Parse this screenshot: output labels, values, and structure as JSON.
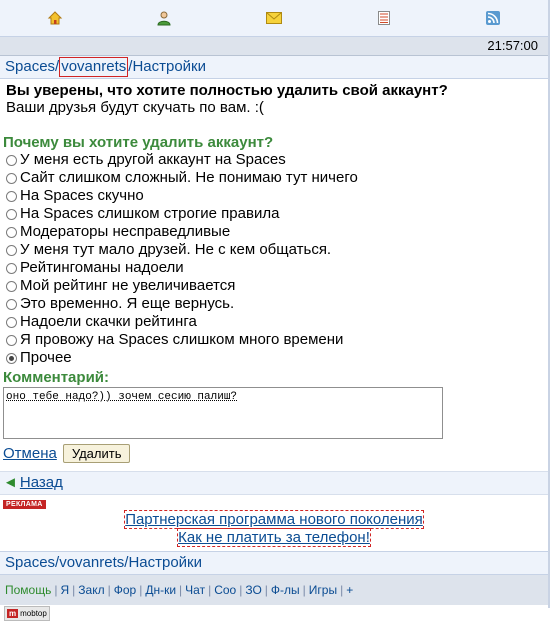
{
  "topnav": {
    "icons": [
      "home-icon",
      "user-icon",
      "mail-icon",
      "list-icon",
      "rss-icon"
    ]
  },
  "time": "21:57:00",
  "breadcrumb": {
    "site": "Spaces",
    "user": "vovanrets",
    "page": "Настройки"
  },
  "question": {
    "title": "Вы уверены, что хотите полностью удалить свой аккаунт?",
    "subtitle": "Ваши друзья будут скучать по вам. :("
  },
  "reasons": {
    "title": "Почему вы хотите удалить аккаунт?",
    "options": [
      "У меня есть другой аккаунт на Spaces",
      "Сайт слишком сложный. Не понимаю тут ничего",
      "На Spaces скучно",
      "На Spaces слишком строгие правила",
      "Модераторы несправедливые",
      "У меня тут мало друзей. Не с кем общаться.",
      "Рейтингоманы надоели",
      "Мой рейтинг не увеличивается",
      "Это временно. Я еще вернусь.",
      "Надоели скачки рейтинга",
      "Я провожу на Spaces слишком много времени",
      "Прочее"
    ],
    "selected_index": 11
  },
  "comment": {
    "label": "Комментарий:",
    "value": "оно тебе надо?)) зочем сесию палиш?"
  },
  "actions": {
    "cancel": "Отмена",
    "delete": "Удалить"
  },
  "back": "Назад",
  "ad": {
    "label": "РЕКЛАМА",
    "links": [
      "Партнерская программа нового поколения",
      "Как не платить за телефон!"
    ]
  },
  "bottom_nav": [
    "Помощь",
    "Я",
    "Закл",
    "Фор",
    "Дн-ки",
    "Чат",
    "Соо",
    "ЗО",
    "Ф-лы",
    "Игры",
    "+"
  ],
  "footer_badge": "mobtop"
}
